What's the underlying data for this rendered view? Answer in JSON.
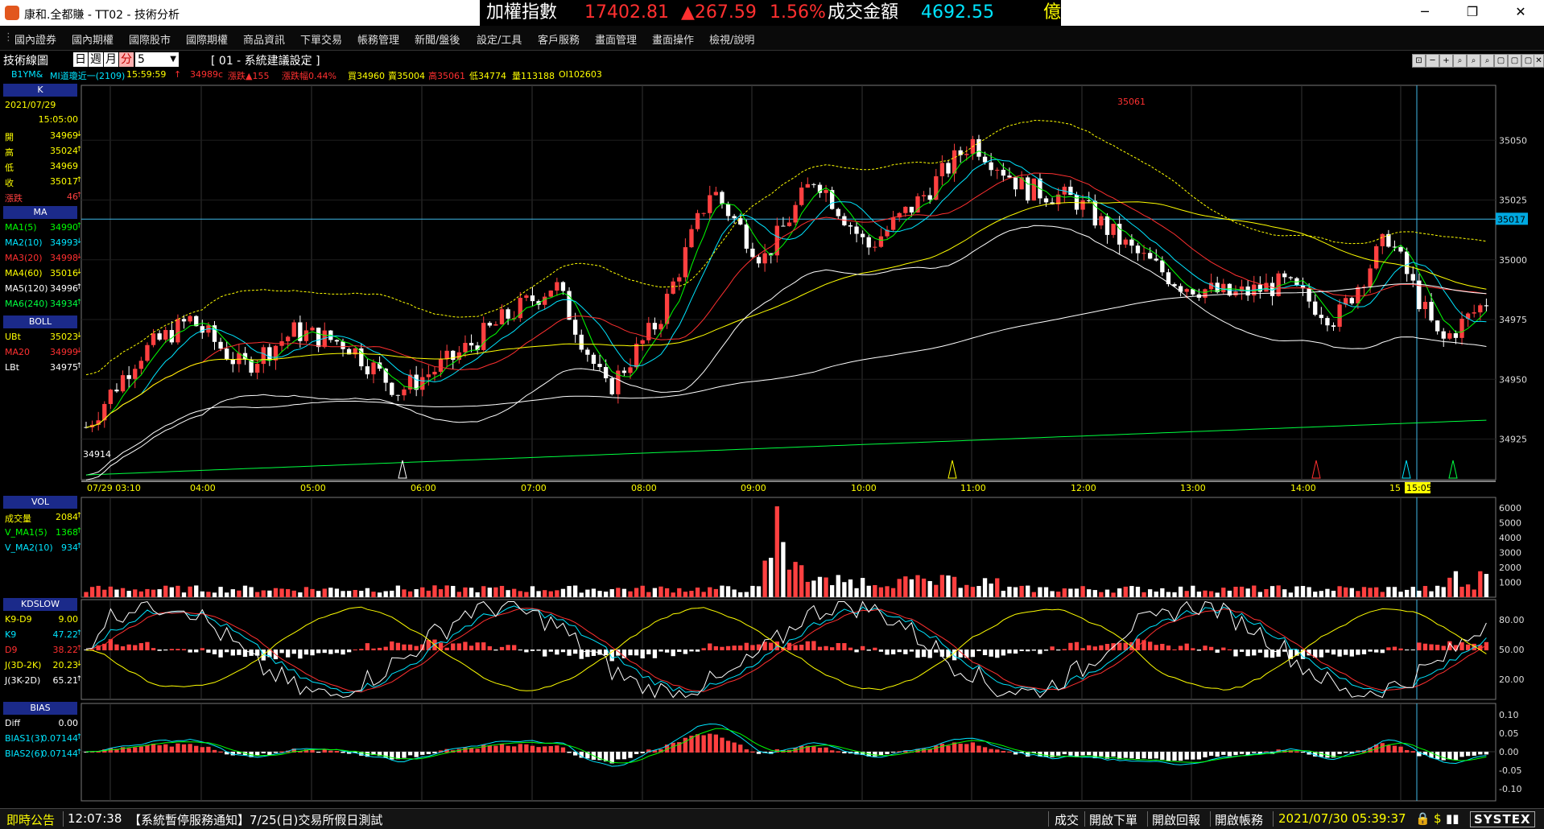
{
  "window": {
    "title": "康和.全都賺 - TT02 - 技術分析",
    "min": "─",
    "max": "❐",
    "close": "✕"
  },
  "ticker": {
    "index_label": "加權指數",
    "index_value": "17402.81",
    "change": "▲267.59",
    "pct": "1.56%",
    "turnover_label": "成交金額",
    "turnover_value": "4692.55",
    "unit": "億"
  },
  "menu": [
    "國內證券",
    "國內期權",
    "國際股市",
    "國際期權",
    "商品資訊",
    "下單交易",
    "帳務管理",
    "新聞/盤後",
    "設定/工具",
    "客戶服務",
    "畫面管理",
    "畫面操作",
    "檢視/說明"
  ],
  "toolbar": {
    "label": "技術線圖",
    "period_buttons": [
      "日",
      "週",
      "月",
      "分"
    ],
    "interval": "5",
    "setting": "[ 01 - 系統建議設定 ]"
  },
  "icon_buttons": [
    "⊡",
    "─",
    "+",
    "⌕",
    "⌕",
    "⌕",
    "▢",
    "▢",
    "▢",
    "✕"
  ],
  "info": {
    "symbol": "B1YM&",
    "name": "MI道瓊近一(2109)",
    "time": "15:59:59",
    "arrow": "↑",
    "price": "34989c",
    "change": "漲跌▲155",
    "pct": "漲跌幅0.44%",
    "bid": "買34960",
    "ask": "賣35004",
    "high": "高35061",
    "low": "低34774",
    "volume": "量113188",
    "oi": "OI102603"
  },
  "k_panel": {
    "header": "K",
    "date": "2021/07/29",
    "time": "15:05:00",
    "rows": [
      {
        "label": "開",
        "value": "34969",
        "arrow": "↓",
        "color": "#ffff00"
      },
      {
        "label": "高",
        "value": "35024",
        "arrow": "↑",
        "color": "#ffff00"
      },
      {
        "label": "低",
        "value": "34969",
        "arrow": "",
        "color": "#ffff00"
      },
      {
        "label": "收",
        "value": "35017",
        "arrow": "↑",
        "color": "#ffff00"
      },
      {
        "label": "漲跌",
        "value": "46",
        "arrow": "↑",
        "color": "#ff4040"
      }
    ]
  },
  "ma_panel": {
    "header": "MA",
    "rows": [
      {
        "label": "MA1(5)",
        "value": "34990",
        "arrow": "↑",
        "color": "#00ff00"
      },
      {
        "label": "MA2(10)",
        "value": "34993",
        "arrow": "↓",
        "color": "#00e5ff"
      },
      {
        "label": "MA3(20)",
        "value": "34998",
        "arrow": "↓",
        "color": "#ff3030"
      },
      {
        "label": "MA4(60)",
        "value": "35016",
        "arrow": "↓",
        "color": "#ffff00"
      },
      {
        "label": "MA5(120)",
        "value": "34996",
        "arrow": "↑",
        "color": "#ffffff"
      },
      {
        "label": "MA6(240)",
        "value": "34934",
        "arrow": "↑",
        "color": "#00ff40"
      }
    ]
  },
  "boll_panel": {
    "header": "BOLL",
    "rows": [
      {
        "label": "UBt",
        "value": "35023",
        "arrow": "↓",
        "color": "#ffff00"
      },
      {
        "label": "MA20",
        "value": "34999",
        "arrow": "↓",
        "color": "#ff3030"
      },
      {
        "label": "LBt",
        "value": "34975",
        "arrow": "↑",
        "color": "#ffffff"
      }
    ]
  },
  "vol_panel": {
    "header": "VOL",
    "rows": [
      {
        "label": "成交量",
        "value": "2084",
        "arrow": "↑",
        "color": "#ffff00"
      },
      {
        "label": "V_MA1(5)",
        "value": "1368",
        "arrow": "↑",
        "color": "#00ff00"
      },
      {
        "label": "V_MA2(10)",
        "value": "934",
        "arrow": "↑",
        "color": "#00e5ff"
      }
    ]
  },
  "kd_panel": {
    "header": "KDSLOW",
    "rows": [
      {
        "label": "K9-D9",
        "value": "9.00",
        "arrow": "",
        "color": "#ffff00"
      },
      {
        "label": "K9",
        "value": "47.22",
        "arrow": "↑",
        "color": "#00e5ff"
      },
      {
        "label": "D9",
        "value": "38.22",
        "arrow": "↑",
        "color": "#ff3030"
      },
      {
        "label": "J(3D-2K)",
        "value": "20.23",
        "arrow": "↓",
        "color": "#ffff00"
      },
      {
        "label": "J(3K-2D)",
        "value": "65.21",
        "arrow": "↑",
        "color": "#ffffff"
      }
    ]
  },
  "bias_panel": {
    "header": "BIAS",
    "rows": [
      {
        "label": "Diff",
        "value": "0.00",
        "arrow": "",
        "color": "#ffffff"
      },
      {
        "label": "BIAS1(3)",
        "value": "0.07144",
        "arrow": "↑",
        "color": "#00e5ff"
      },
      {
        "label": "BIAS2(6)",
        "value": "0.07144",
        "arrow": "↑",
        "color": "#00e5ff"
      }
    ]
  },
  "chart_data": {
    "type": "candlestick",
    "price_axis": {
      "ticks": [
        35050,
        35025,
        35000,
        34975,
        34950,
        34925
      ],
      "min": 34908,
      "max": 35073
    },
    "time_labels": [
      "07/29 03:10",
      "04:00",
      "05:00",
      "06:00",
      "07:00",
      "08:00",
      "09:00",
      "10:00",
      "11:00",
      "12:00",
      "13:00",
      "14:00",
      "15",
      "15:05"
    ],
    "current_price_label": "35017",
    "high_marker": "35061",
    "low_marker": "34914",
    "vol_axis": [
      "6000",
      "5000",
      "4000",
      "3000",
      "2000",
      "1000"
    ],
    "kd_axis": [
      "80.00",
      "50.00",
      "20.00"
    ],
    "bias_axis": [
      "0.10",
      "0.05",
      "0.00",
      "-0.05",
      "-0.10"
    ]
  },
  "status": {
    "label": "即時公告",
    "time": "12:07:38",
    "notice": "【系統暫停服務通知】7/25(日)交易所假日測試",
    "buttons": [
      "成交",
      "開啟下單",
      "開啟回報",
      "開啟帳務"
    ],
    "clock": "2021/07/30 05:39:37",
    "brand": "SYSTEX"
  }
}
